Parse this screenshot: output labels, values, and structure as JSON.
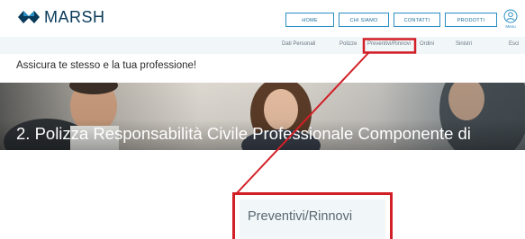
{
  "brand": {
    "name": "MARSH",
    "color": "#0a3a5a"
  },
  "topnav": {
    "items": [
      "HOME",
      "CHI SIAMO",
      "CONTATTI",
      "PRODOTTI"
    ]
  },
  "menu": {
    "icon": "user-circle-icon",
    "label": "Menu"
  },
  "subnav": {
    "items": [
      "Dati Personali",
      "Polizze",
      "Preventivi/Rinnovi",
      "Ordini",
      "Sinistri",
      "Esci"
    ],
    "highlighted": "Preventivi/Rinnovi"
  },
  "tagline": "Assicura te stesso e la tua professione!",
  "hero": {
    "title": "2. Polizza Responsabilità Civile Professionale Componente di"
  },
  "zoom": {
    "label": "Preventivi/Rinnovi"
  },
  "colors": {
    "accent": "#2b8fc4",
    "highlight": "#d21f26",
    "subnav_bg": "#f1f6f9"
  }
}
